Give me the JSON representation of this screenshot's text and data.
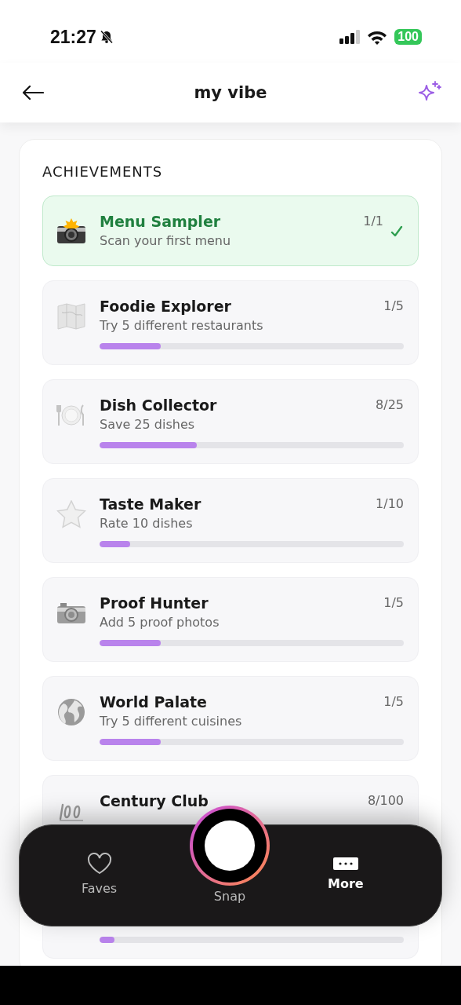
{
  "status_bar": {
    "time": "21:27",
    "battery": "100"
  },
  "header": {
    "title": "my vibe"
  },
  "section": {
    "title": "ACHIEVEMENTS"
  },
  "achievements": [
    {
      "title": "Menu Sampler",
      "subtitle": "Scan your first menu",
      "count": "1/1",
      "completed": true
    },
    {
      "title": "Foodie Explorer",
      "subtitle": "Try 5 different restaurants",
      "count": "1/5",
      "completed": false,
      "level": 0.2
    },
    {
      "title": "Dish Collector",
      "subtitle": "Save 25 dishes",
      "count": "8/25",
      "completed": false,
      "level": 0.32
    },
    {
      "title": "Taste Maker",
      "subtitle": "Rate 10 dishes",
      "count": "1/10",
      "completed": false,
      "level": 0.1
    },
    {
      "title": "Proof Hunter",
      "subtitle": "Add 5 proof photos",
      "count": "1/5",
      "completed": false,
      "level": 0.2
    },
    {
      "title": "World Palate",
      "subtitle": "Try 5 different cuisines",
      "count": "1/5",
      "completed": false,
      "level": 0.2
    },
    {
      "title": "Century Club",
      "count": "8/100",
      "completed": false
    },
    {
      "completed": false,
      "level": 0.05
    }
  ],
  "nav": [
    {
      "label": "Faves",
      "kind": "faves",
      "selected": false
    },
    {
      "label": "Snap",
      "kind": "snap",
      "selected": false
    },
    {
      "label": "More",
      "kind": "more",
      "selected": true
    }
  ]
}
